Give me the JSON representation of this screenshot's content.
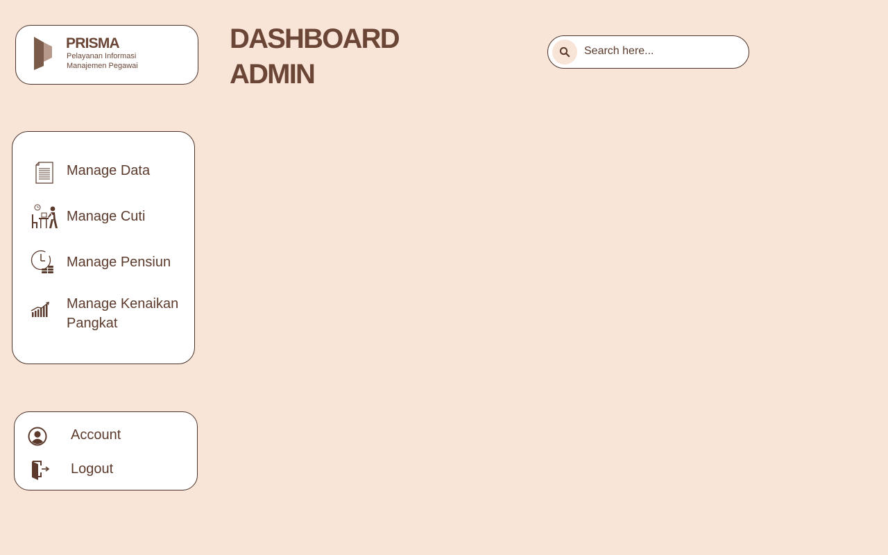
{
  "brand": {
    "name": "PRISMA",
    "subtitle_line1": "Pelayanan Informasi",
    "subtitle_line2": "Manajemen Pegawai"
  },
  "header": {
    "title_line1": "DASHBOARD",
    "title_line2": "ADMIN"
  },
  "search": {
    "placeholder": "Search here...",
    "value": ""
  },
  "sidebar": {
    "items": [
      {
        "label": "Manage Data",
        "icon": "document-icon"
      },
      {
        "label": "Manage Cuti",
        "icon": "leave-icon"
      },
      {
        "label": "Manage Pensiun",
        "icon": "pension-clock-icon"
      },
      {
        "label_line1": "Manage Kenaikan",
        "label_line2": "Pangkat",
        "icon": "growth-chart-icon"
      }
    ]
  },
  "account_menu": {
    "items": [
      {
        "label": "Account",
        "icon": "user-circle-icon"
      },
      {
        "label": "Logout",
        "icon": "logout-door-icon"
      }
    ]
  },
  "colors": {
    "background": "#f8e5d8",
    "panel": "#ffffff",
    "brand_brown": "#6b4536",
    "text_brown": "#5b3a2c",
    "border": "#4a3228"
  }
}
